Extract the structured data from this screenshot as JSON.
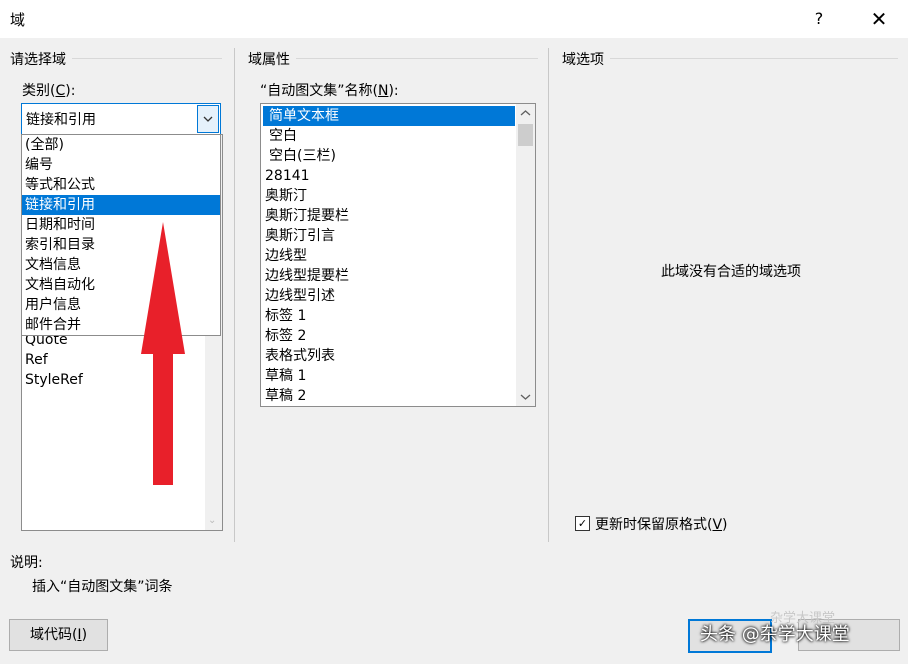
{
  "window": {
    "title": "域",
    "help": "?",
    "close": "✕"
  },
  "left_group": {
    "title": "请选择域",
    "category_label": "类别(",
    "category_hotkey": "C",
    "category_label_end": "):",
    "combo_value": "链接和引用",
    "dropdown_options": [
      "(全部)",
      "编号",
      "等式和公式",
      "链接和引用",
      "日期和时间",
      "索引和目录",
      "文档信息",
      "文档自动化",
      "用户信息",
      "邮件合并"
    ],
    "field_names_visible": [
      "Quote",
      "Ref",
      "StyleRef"
    ]
  },
  "middle_group": {
    "title": "域属性",
    "list_label": "“自动图文集”名称(",
    "list_hotkey": "N",
    "list_label_end": "):",
    "items": [
      "简单文本框",
      "空白",
      "空白(三栏)",
      "28141",
      "奥斯汀",
      "奥斯汀提要栏",
      "奥斯汀引言",
      "边线型",
      "边线型提要栏",
      "边线型引述",
      "标签 1",
      "标签 2",
      "表格式列表",
      "草稿 1",
      "草稿 2"
    ]
  },
  "right_group": {
    "title": "域选项",
    "no_options_text": "此域没有合适的域选项",
    "checkbox_label": "更新时保留原格式(",
    "checkbox_hotkey": "V",
    "checkbox_label_end": ")",
    "checkbox_checked": true
  },
  "description": {
    "label": "说明:",
    "text": "插入“自动图文集”词条"
  },
  "buttons": {
    "field_codes": "域代码(",
    "field_codes_hotkey": "I",
    "field_codes_end": ")"
  },
  "watermark": {
    "text": "头条 @杂学大课堂",
    "faint": "杂学大课堂"
  },
  "colors": {
    "selection": "#0078d7",
    "arrow": "#e8202a"
  }
}
